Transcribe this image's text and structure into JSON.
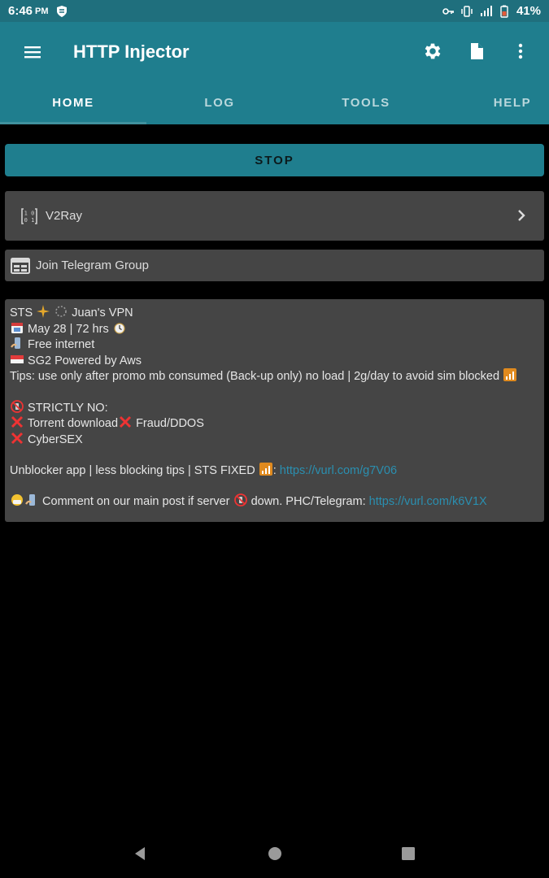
{
  "status_bar": {
    "time": "6:46",
    "ampm": "PM",
    "battery": "41%"
  },
  "app_bar": {
    "title": "HTTP Injector"
  },
  "tabs": [
    {
      "label": "HOME",
      "active": true
    },
    {
      "label": "LOG",
      "active": false
    },
    {
      "label": "TOOLS",
      "active": false
    },
    {
      "label": "HELP",
      "active": false
    }
  ],
  "stop_button": "STOP",
  "v2ray_card": {
    "label": "V2Ray"
  },
  "telegram_card": {
    "label": "Join Telegram Group"
  },
  "message": {
    "line1_a": "STS",
    "line1_b": "Juan's VPN",
    "line2": "May 28 | 72 hrs",
    "line3": "Free internet",
    "line4": "SG2 Powered by Aws",
    "line5": "Tips: use only after promo mb consumed (Back-up only) no load | 2g/day to avoid sim blocked",
    "line6": "STRICTLY NO:",
    "line7_a": "Torrent download",
    "line7_b": "Fraud/DDOS",
    "line8": "CyberSEX",
    "line9_text": "Unblocker app | less blocking tips | STS FIXED",
    "line9_sep": ":",
    "line9_link": "https://vurl.com/g7V06",
    "line10_text": "Comment on our main post if server",
    "line10_text2": "down. PHC/Telegram:",
    "line10_link": "https://vurl.com/k6V1X"
  },
  "colors": {
    "primary": "#1f7e8e",
    "status": "#1f6f7d",
    "card": "#454545",
    "link": "#2a8fb0"
  }
}
